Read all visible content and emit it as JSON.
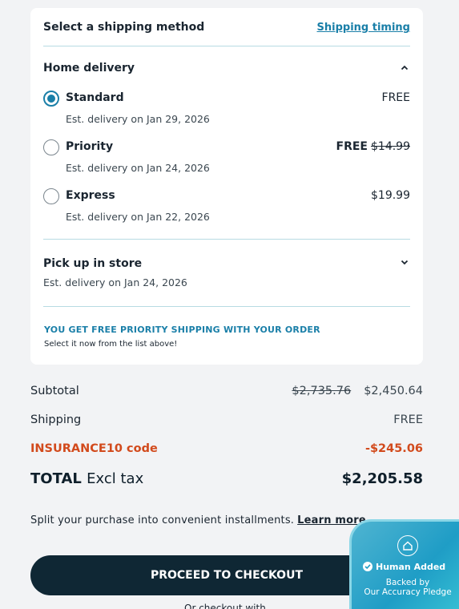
{
  "shipping": {
    "title": "Select a shipping method",
    "timing_link": "Shipping timing",
    "home_delivery": {
      "title": "Home delivery",
      "expanded": true,
      "options": [
        {
          "name": "Standard",
          "est": "Est. delivery on Jan 29, 2026",
          "price": "FREE",
          "selected": true
        },
        {
          "name": "Priority",
          "est": "Est. delivery on Jan 24, 2026",
          "price": "FREE",
          "original_price": "$14.99",
          "selected": false
        },
        {
          "name": "Express",
          "est": "Est. delivery on Jan 22, 2026",
          "price": "$19.99",
          "selected": false
        }
      ]
    },
    "pickup": {
      "title": "Pick up in store",
      "est": "Est. delivery on Jan 24, 2026",
      "expanded": false
    },
    "promo": {
      "headline": "YOU GET FREE PRIORITY SHIPPING WITH YOUR ORDER",
      "sub": "Select it now from the list above!"
    }
  },
  "summary": {
    "subtotal_label": "Subtotal",
    "subtotal_original": "$2,735.76",
    "subtotal_value": "$2,450.64",
    "shipping_label": "Shipping",
    "shipping_value": "FREE",
    "promo_label": "INSURANCE10 code",
    "promo_value": "-$245.06",
    "total_label": "TOTAL",
    "total_qualifier": "Excl tax",
    "total_value": "$2,205.58"
  },
  "installments": {
    "text": "Split your purchase into convenient installments.",
    "link": "Learn more"
  },
  "checkout": {
    "button": "PROCEED TO CHECKOUT",
    "or_text": "Or checkout with"
  },
  "badge": {
    "line1": "Human Added",
    "line2": "Backed by",
    "line3": "Our Accuracy Pledge"
  },
  "colors": {
    "accent": "#1a7fa8",
    "discount": "#d24a1c",
    "button": "#0f2734",
    "badge": "#1f9dc6"
  }
}
